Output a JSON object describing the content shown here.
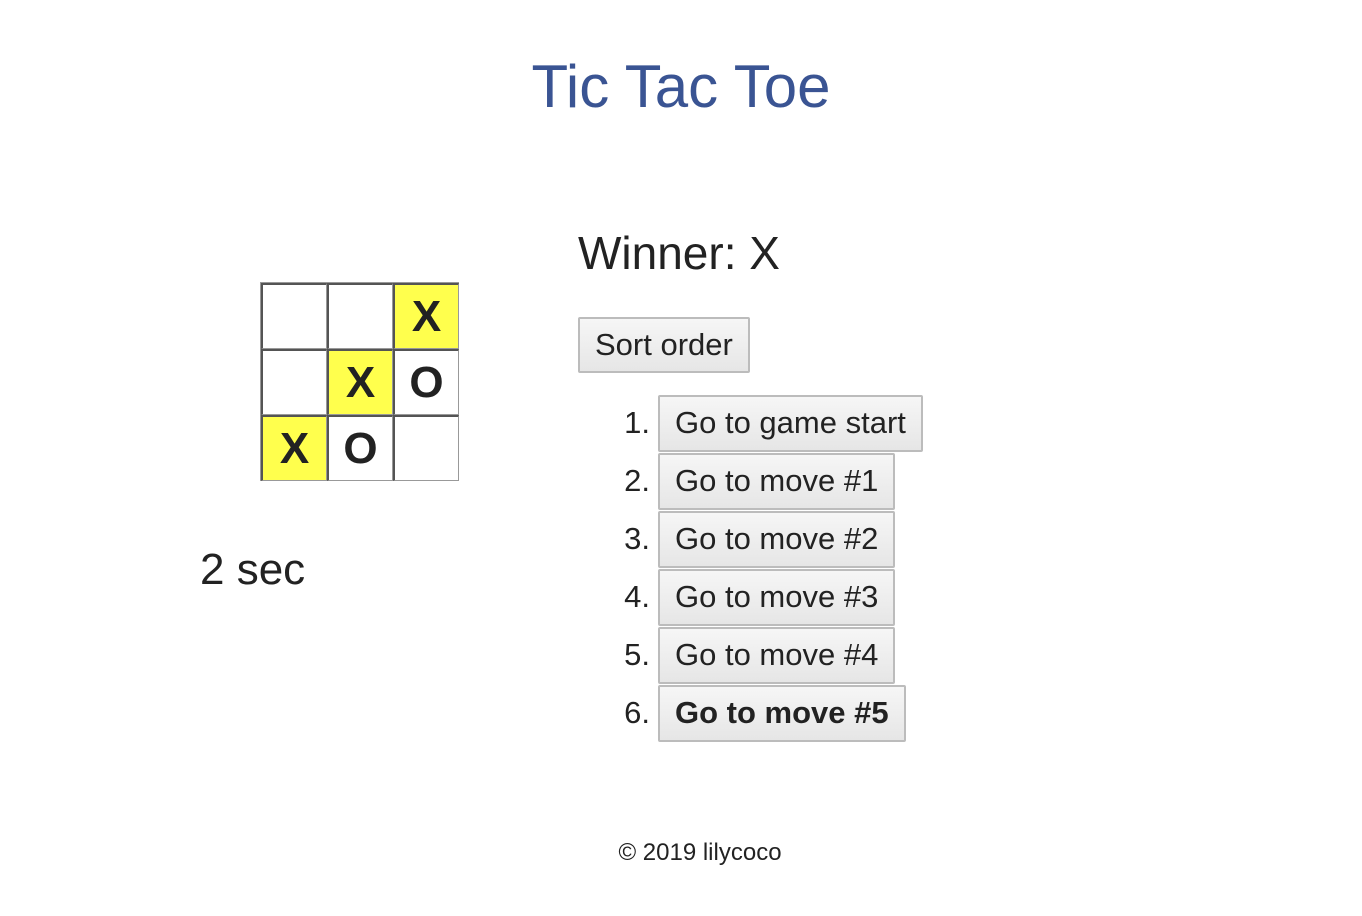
{
  "header": {
    "title": "Tic Tac Toe"
  },
  "board": {
    "squares": [
      "",
      "",
      "X",
      "",
      "X",
      "O",
      "X",
      "O",
      ""
    ],
    "winning_line": [
      2,
      4,
      6
    ],
    "highlight_color": "#ffff4d"
  },
  "timer": {
    "text": "2 sec"
  },
  "status": {
    "text": "Winner: X"
  },
  "sort_button": {
    "label": "Sort order"
  },
  "moves": [
    {
      "number": "1.",
      "label": "Go to game start"
    },
    {
      "number": "2.",
      "label": "Go to move #1"
    },
    {
      "number": "3.",
      "label": "Go to move #2"
    },
    {
      "number": "4.",
      "label": "Go to move #3"
    },
    {
      "number": "5.",
      "label": "Go to move #4"
    },
    {
      "number": "6.",
      "label": "Go to move #5",
      "current": true
    }
  ],
  "footer": {
    "text": "© 2019 lilycoco"
  },
  "colors": {
    "title": "#3a5493",
    "text": "#222222",
    "border": "#999999"
  }
}
